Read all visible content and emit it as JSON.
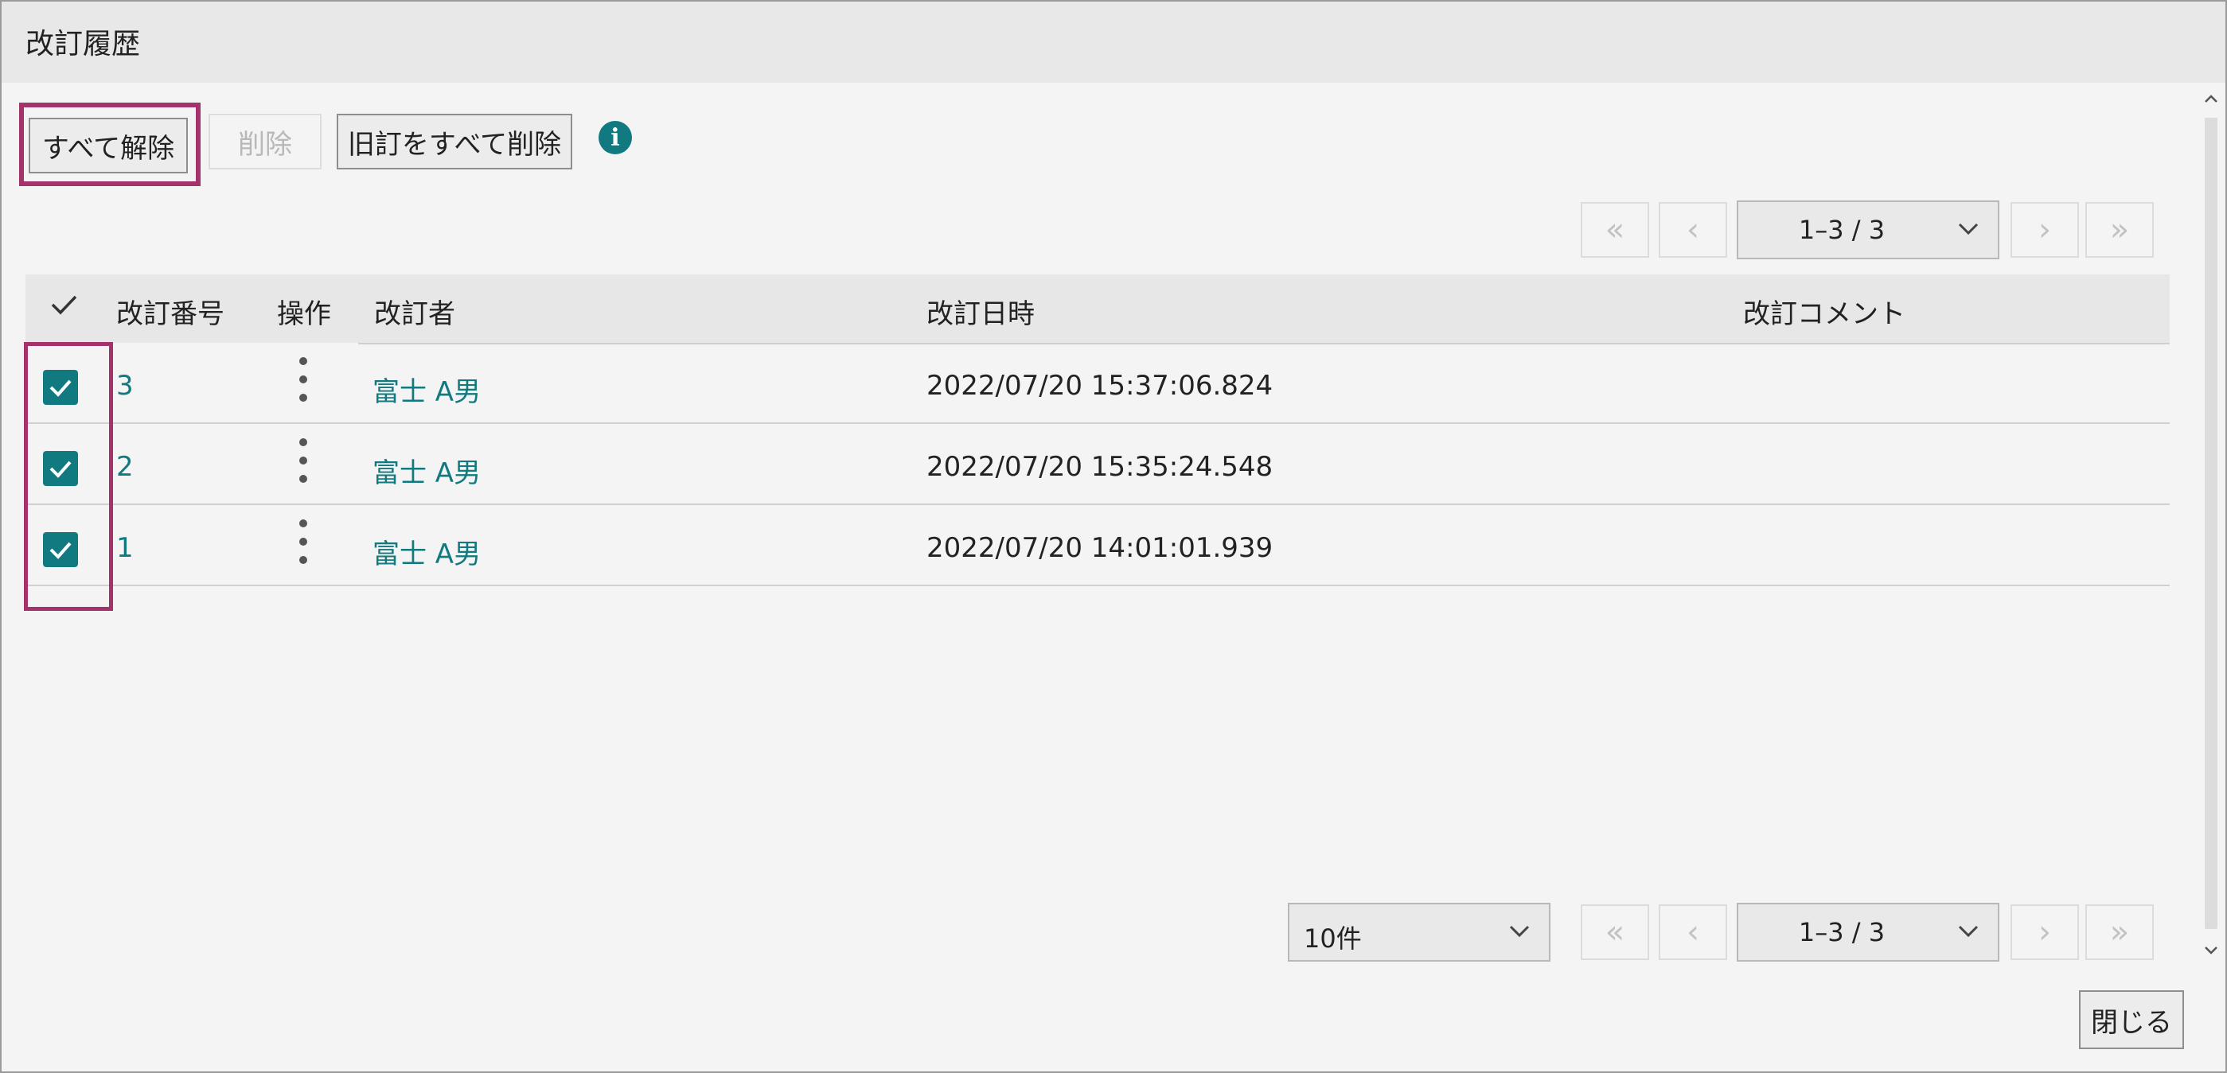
{
  "window": {
    "title": "改訂履歴"
  },
  "toolbar": {
    "deselect_all_label": "すべて解除",
    "delete_label": "削除",
    "delete_old_label": "旧訂をすべて削除",
    "info_glyph": "i"
  },
  "pager_top": {
    "first_glyph": "«",
    "prev_glyph": "‹",
    "range_label": "1–3 / 3",
    "next_glyph": "›",
    "last_glyph": "»"
  },
  "pager_bottom": {
    "per_page_label": "10件",
    "first_glyph": "«",
    "prev_glyph": "‹",
    "range_label": "1–3 / 3",
    "next_glyph": "›",
    "last_glyph": "»"
  },
  "table": {
    "headers": {
      "revision_no": "改訂番号",
      "operation": "操作",
      "reviser": "改訂者",
      "datetime": "改訂日時",
      "comment": "改訂コメント"
    },
    "rows": [
      {
        "checked": true,
        "revision_no": "3",
        "reviser": "富士 A男",
        "datetime": "2022/07/20 15:37:06.824",
        "comment": ""
      },
      {
        "checked": true,
        "revision_no": "2",
        "reviser": "富士 A男",
        "datetime": "2022/07/20 15:35:24.548",
        "comment": ""
      },
      {
        "checked": true,
        "revision_no": "1",
        "reviser": "富士 A男",
        "datetime": "2022/07/20 14:01:01.939",
        "comment": ""
      }
    ]
  },
  "footer": {
    "close_label": "閉じる"
  },
  "colors": {
    "accent": "#117a80",
    "highlight": "#a3336a"
  }
}
